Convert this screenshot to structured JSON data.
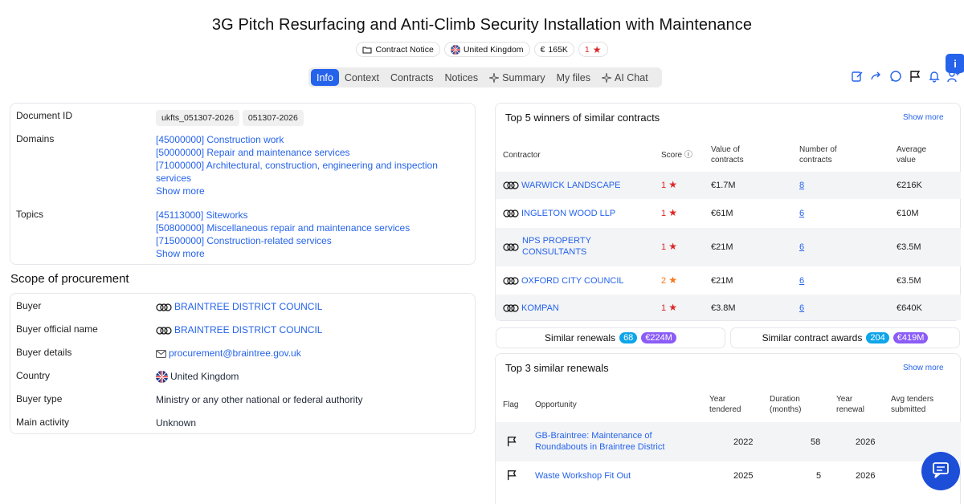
{
  "title": "3G Pitch Resurfacing and Anti-Climb Security Installation with Maintenance",
  "badges": {
    "notice_type": "Contract Notice",
    "country": "United Kingdom",
    "value": "165K",
    "value_currency": "€",
    "score": "1"
  },
  "tabs": [
    "Info",
    "Context",
    "Contracts",
    "Notices",
    "Summary",
    "My files",
    "AI Chat"
  ],
  "active_tab": "Info",
  "info_button": "i",
  "details": {
    "document_id_label": "Document ID",
    "document_ids": [
      "ukfts_051307-2026",
      "051307-2026"
    ],
    "domains_label": "Domains",
    "domains": [
      "[45000000] Construction work",
      "[50000000] Repair and maintenance services",
      "[71000000] Architectural, construction, engineering and inspection services"
    ],
    "topics_label": "Topics",
    "topics": [
      "[45113000] Siteworks",
      "[50800000] Miscellaneous repair and maintenance services",
      "[71500000] Construction-related services"
    ],
    "show_more": "Show more"
  },
  "scope": {
    "title": "Scope of procurement",
    "rows": [
      {
        "label": "Buyer",
        "value": "BRAINTREE DISTRICT COUNCIL"
      },
      {
        "label": "Buyer official name",
        "value": "BRAINTREE DISTRICT COUNCIL"
      },
      {
        "label": "Buyer details",
        "value": "procurement@braintree.gov.uk"
      },
      {
        "label": "Country",
        "value": "United Kingdom"
      },
      {
        "label": "Buyer type",
        "value": "Ministry or any other national or federal authority"
      },
      {
        "label": "Main activity",
        "value": "Unknown"
      }
    ]
  },
  "winners": {
    "title": "Top 5 winners of similar contracts",
    "show_more": "Show more",
    "headers": {
      "contractor": "Contractor",
      "score": "Score",
      "value_1": "Value of",
      "value_2": "contracts",
      "number_1": "Number of",
      "number_2": "contracts",
      "average_1": "Average",
      "average_2": "value"
    },
    "rows": [
      {
        "name": "WARWICK LANDSCAPE",
        "name2": "",
        "score": "1",
        "value": "€1.7M",
        "number": "8",
        "average": "€216K"
      },
      {
        "name": "INGLETON WOOD LLP",
        "name2": "",
        "score": "1",
        "value": "€61M",
        "number": "6",
        "average": "€10M"
      },
      {
        "name": "NPS PROPERTY",
        "name2": "CONSULTANTS",
        "score": "1",
        "value": "€21M",
        "number": "6",
        "average": "€3.5M"
      },
      {
        "name": "OXFORD CITY COUNCIL",
        "name2": "",
        "score": "2",
        "value": "€21M",
        "number": "6",
        "average": "€3.5M"
      },
      {
        "name": "KOMPAN",
        "name2": "",
        "score": "1",
        "value": "€3.8M",
        "number": "6",
        "average": "€640K"
      }
    ]
  },
  "similar": {
    "renewals_label": "Similar renewals",
    "renewals_count": "68",
    "renewals_amount": "€224M",
    "awards_label": "Similar contract awards",
    "awards_count": "204",
    "awards_amount": "€419M"
  },
  "renewals": {
    "title": "Top 3 similar renewals",
    "show_more": "Show more",
    "headers": {
      "flag": "Flag",
      "opportunity": "Opportunity",
      "year_tendered_1": "Year",
      "year_tendered_2": "tendered",
      "duration_1": "Duration",
      "duration_2": "(months)",
      "year_renewal_1": "Year",
      "year_renewal_2": "renewal",
      "avg_1": "Avg tenders",
      "avg_2": "submitted"
    },
    "rows": [
      {
        "opportunity": "GB-Braintree: Maintenance of",
        "opportunity2": "Roundabouts in Braintree District",
        "year_tendered": "2022",
        "duration": "58",
        "year_renewal": "2026"
      },
      {
        "opportunity": "Waste Workshop Fit Out",
        "opportunity2": "",
        "year_tendered": "2025",
        "duration": "5",
        "year_renewal": "2026"
      }
    ]
  },
  "colors": {
    "accent": "#2563eb",
    "star_red": "#dc2626",
    "star_orange": "#f97316",
    "count_badge": "#0ea5e9",
    "amount_badge": "#8b5cf6"
  }
}
